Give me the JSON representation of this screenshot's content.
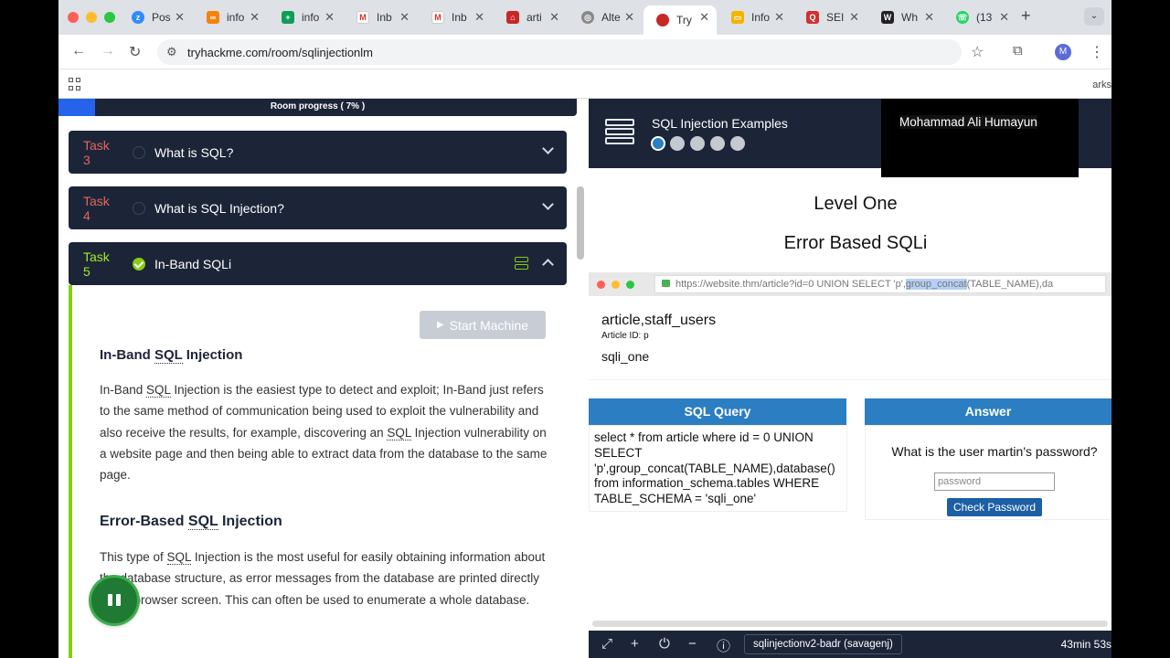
{
  "browser": {
    "tabs": [
      "Pos",
      "info",
      "info",
      "Inb",
      "Inb",
      "arti",
      "Alte",
      "Try",
      "Info",
      "SEI",
      "Wh",
      "(13"
    ],
    "url": "tryhackme.com/room/sqlinjectionlm",
    "profile_initial": "M",
    "bookmarks_label": "arks"
  },
  "left": {
    "progress_label": "Room progress ( 7% )",
    "progress_percent": 7,
    "tasks": [
      {
        "number": "Task 3",
        "title": "What is SQL?"
      },
      {
        "number": "Task 4",
        "title": "What is SQL Injection?"
      },
      {
        "number": "Task 5",
        "title": "In-Band SQLi"
      }
    ],
    "start_machine": "Start Machine",
    "heading1_pre": "In-Band ",
    "heading1_sql": "SQL",
    "heading1_post": " Injection",
    "para1_a": "In-Band ",
    "para1_b": "SQL",
    "para1_c": " Injection is the easiest type to detect and exploit; In-Band just refers to the same method of communication being used to exploit the vulnerability and also receive the results, for example, discovering an ",
    "para1_d": "SQL",
    "para1_e": " Injection vulnerability on a website page and then being able to extract data from the database to the same page.",
    "heading2_pre": "Error-Based ",
    "heading2_sql": "SQL",
    "heading2_post": " Injection",
    "para2_a": "This type of ",
    "para2_b": "SQL",
    "para2_c": " Injection is the most useful for easily obtaining information about the database structure, as error messages from the database are printed directly to the browser screen. This can often be used to enumerate a whole database."
  },
  "right": {
    "header_title": "SQL Injection Examples",
    "webcam_name": "Mohammad Ali Humayun",
    "level": "Level One",
    "subtitle": "Error Based SQLi",
    "mock_url_pre": "https://website.thm/article?id=0 UNION SELECT 'p',",
    "mock_url_sel": "group_concat",
    "mock_url_post": "(TABLE_NAME),da",
    "article_title": "article,staff_users",
    "article_id": "Article ID: p",
    "article_body": "sqli_one",
    "sql_header": "SQL Query",
    "sql_query": "select * from article where id = 0 UNION SELECT 'p',group_concat(TABLE_NAME),database() from information_schema.tables WHERE TABLE_SCHEMA = 'sqli_one'",
    "answer_header": "Answer",
    "question": "What is the user martin's password?",
    "password_placeholder": "password",
    "check_button": "Check Password",
    "vm_name": "sqlinjectionv2-badr (savagenj)",
    "timer": "43min 53s"
  },
  "colors": {
    "accent_green": "#88cc14",
    "navy": "#1c2538",
    "blue": "#2b7ec1"
  }
}
